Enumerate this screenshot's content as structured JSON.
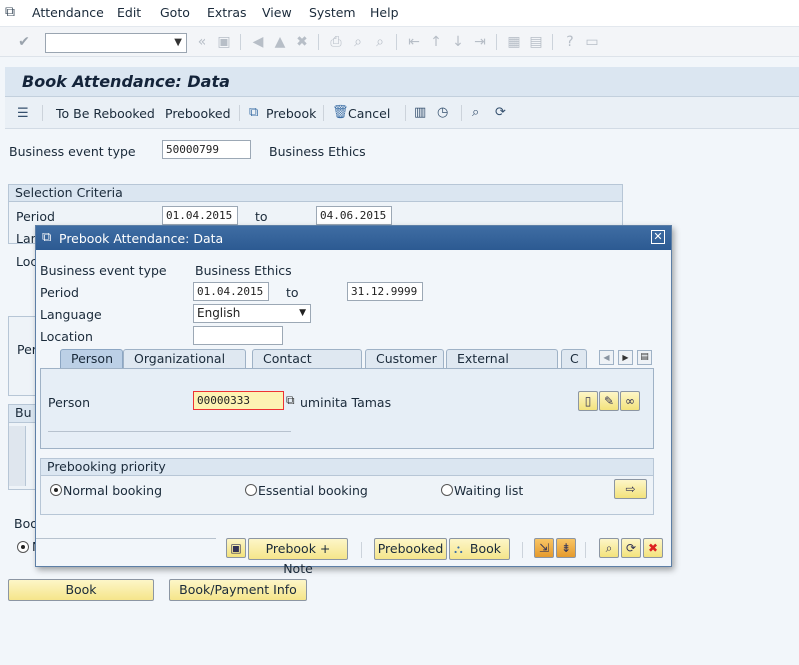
{
  "menu": {
    "items": [
      "Attendance",
      "Edit",
      "Goto",
      "Extras",
      "View",
      "System",
      "Help"
    ]
  },
  "toolbar": {
    "command_value": ""
  },
  "page": {
    "title": "Book Attendance: Data"
  },
  "app_toolbar": {
    "to_be_rebooked": "To Be Rebooked",
    "prebooked": "Prebooked",
    "prebook": "Prebook",
    "cancel": "Cancel"
  },
  "main": {
    "event_type_label": "Business event type",
    "event_type_code": "50000799",
    "event_type_name": "Business Ethics",
    "selection_title": "Selection Criteria",
    "period_label": "Period",
    "period_from": "01.04.2015",
    "period_to_label": "to",
    "period_to": "04.06.2015",
    "language_label_partial": "Lan",
    "location_label_partial": "Loc",
    "person_label_partial": "Per",
    "bu_partial": "Bu",
    "boo_partial": "Boo",
    "n_partial": "N",
    "book_button": "Book",
    "book_payment_button": "Book/Payment Info"
  },
  "dialog": {
    "title": "Prebook Attendance: Data",
    "event_type_label": "Business event type",
    "event_type_name": "Business Ethics",
    "period_label": "Period",
    "period_from": "01.04.2015",
    "period_to_label": "to",
    "period_to": "31.12.9999",
    "language_label": "Language",
    "language_value": "English",
    "location_label": "Location",
    "location_value": "",
    "tabs": [
      "Person",
      "Organizational unit",
      "Contact person",
      "Customer",
      "External person",
      "C"
    ],
    "person_label": "Person",
    "person_value": "00000333",
    "person_name": "uminita Tamas",
    "priority_title": "Prebooking priority",
    "priority_options": [
      "Normal booking",
      "Essential booking",
      "Waiting list"
    ],
    "priority_selected": 0,
    "prebook_note_button": "Prebook + Note",
    "prebooked_button": "Prebooked",
    "book_button": "Book"
  }
}
